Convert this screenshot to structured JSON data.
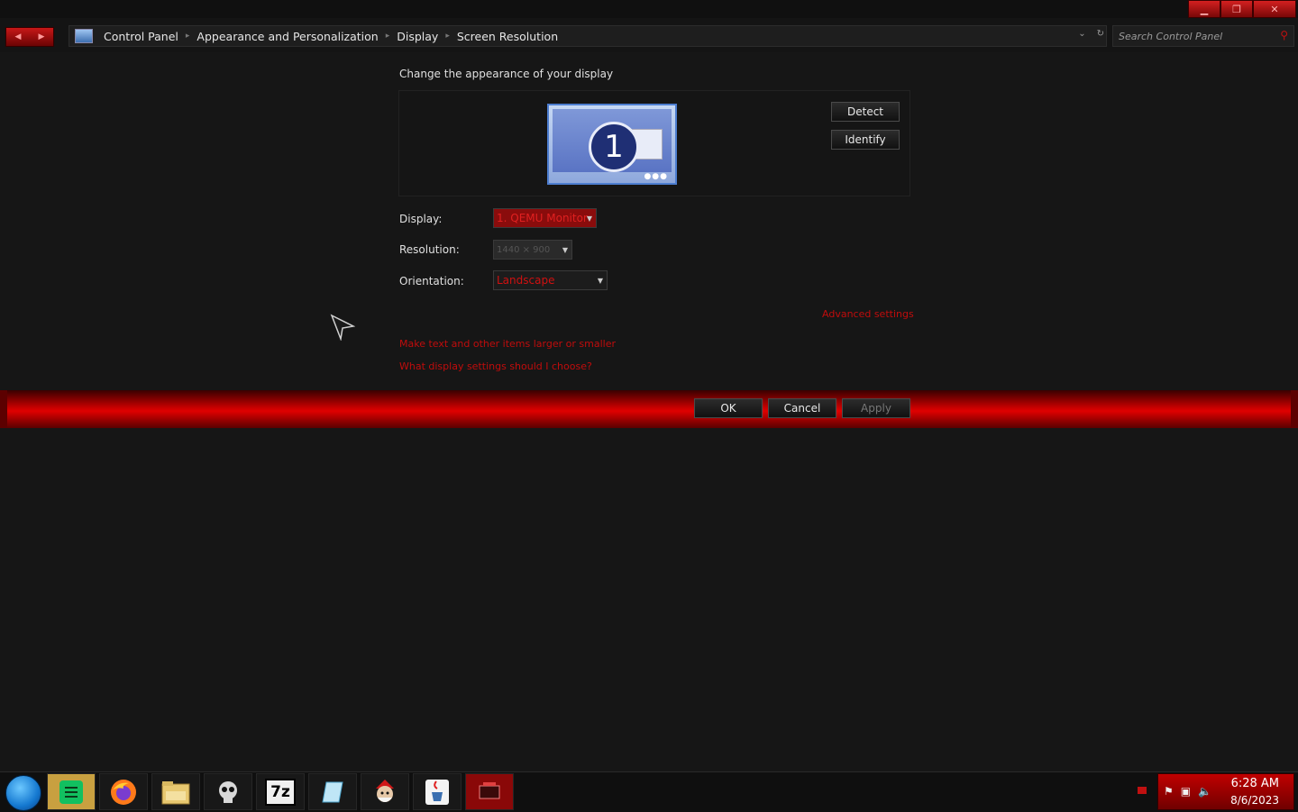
{
  "window": {
    "controls": [
      "minimize",
      "maximize",
      "close"
    ]
  },
  "address_bar": {
    "crumbs": [
      "Control Panel",
      "Appearance and Personalization",
      "Display",
      "Screen Resolution"
    ]
  },
  "search": {
    "placeholder": "Search Control Panel"
  },
  "main": {
    "heading": "Change the appearance of your display",
    "monitor_number": "1",
    "detect_label": "Detect",
    "identify_label": "Identify",
    "display_label": "Display:",
    "display_value": "1. QEMU Monitor",
    "resolution_label": "Resolution:",
    "resolution_value": "1440 × 900",
    "orientation_label": "Orientation:",
    "orientation_value": "Landscape",
    "advanced_link": "Advanced settings",
    "text_size_link": "Make text and other items larger or smaller",
    "help_link": "What display settings should I choose?"
  },
  "footer": {
    "ok_label": "OK",
    "cancel_label": "Cancel",
    "apply_label": "Apply"
  },
  "taskbar": {
    "apps": [
      "notes",
      "firefox",
      "file-explorer",
      "skull-app",
      "7-zip",
      "paper-app",
      "santa-app",
      "java",
      "display-settings"
    ],
    "seven_zip_label": "7z",
    "time": "6:28 AM",
    "date": "8/6/2023"
  }
}
